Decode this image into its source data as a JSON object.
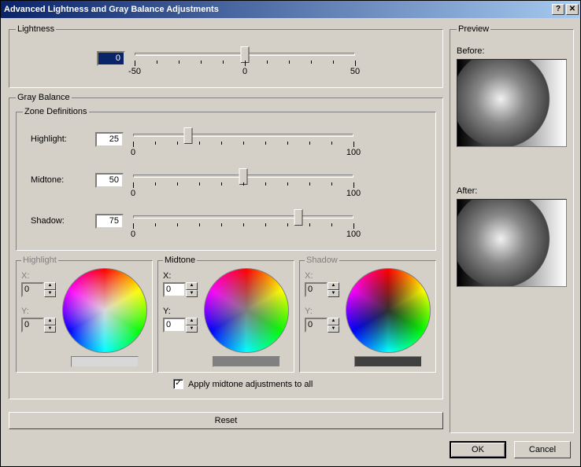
{
  "title": "Advanced Lightness and Gray Balance Adjustments",
  "lightness": {
    "legend": "Lightness",
    "value": "0",
    "min_label": "-50",
    "mid_label": "0",
    "max_label": "50"
  },
  "grayBalance": {
    "legend": "Gray Balance",
    "zoneLegend": "Zone Definitions",
    "highlight": {
      "label": "Highlight:",
      "value": "25"
    },
    "midtone": {
      "label": "Midtone:",
      "value": "50"
    },
    "shadow": {
      "label": "Shadow:",
      "value": "75"
    },
    "tick_min": "0",
    "tick_max": "100"
  },
  "xyBoxes": {
    "highlight": {
      "legend": "Highlight",
      "xLabel": "X:",
      "yLabel": "Y:",
      "x": "0",
      "y": "0",
      "swatch": "#d8d8d8"
    },
    "midtone": {
      "legend": "Midtone",
      "xLabel": "X:",
      "yLabel": "Y:",
      "x": "0",
      "y": "0",
      "swatch": "#808080"
    },
    "shadow": {
      "legend": "Shadow",
      "xLabel": "X:",
      "yLabel": "Y:",
      "x": "0",
      "y": "0",
      "swatch": "#404040"
    }
  },
  "applyMidtone": {
    "label": "Apply midtone adjustments to all",
    "checked": true
  },
  "preview": {
    "legend": "Preview",
    "beforeLabel": "Before:",
    "afterLabel": "After:"
  },
  "buttons": {
    "reset": "Reset",
    "ok": "OK",
    "cancel": "Cancel"
  },
  "sys": {
    "help": "?",
    "close": "✕"
  }
}
